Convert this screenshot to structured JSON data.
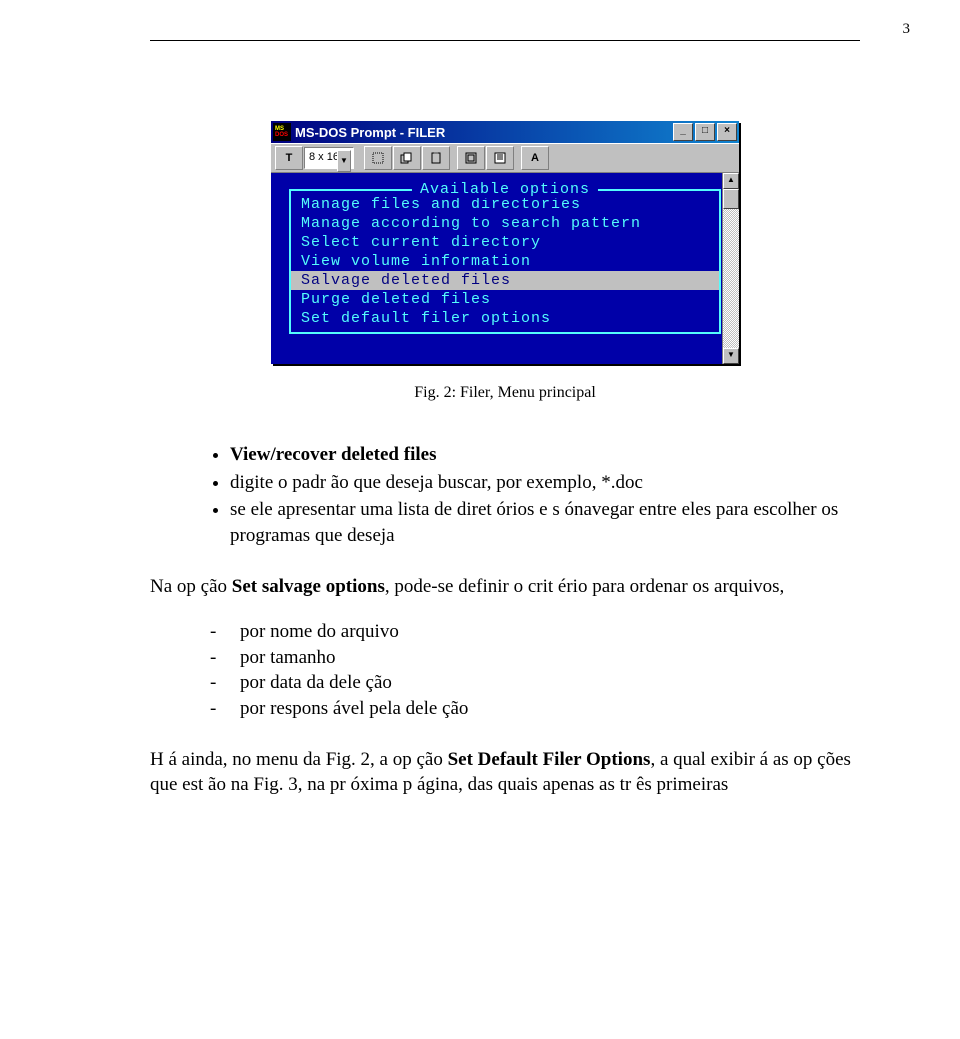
{
  "page_number": "3",
  "window": {
    "title": "MS-DOS Prompt - FILER",
    "font_size": "8 x 16",
    "toolbar_icons": {
      "t_icon": "T",
      "a_icon": "A"
    },
    "panel_title": "Available options",
    "options": [
      "Manage files and directories",
      "Manage according to search pattern",
      "Select current directory",
      "View volume information",
      "Salvage deleted files",
      "Purge deleted files",
      "Set default filer options"
    ],
    "selected_index": 4
  },
  "caption": "Fig. 2: Filer, Menu principal",
  "bullets": [
    {
      "prefix": "",
      "bold": "View/recover deleted files",
      "suffix": ""
    },
    {
      "prefix": "digite o padr ão que deseja buscar, por exemplo, *.doc",
      "bold": "",
      "suffix": ""
    },
    {
      "prefix": "se ele apresentar uma lista de diret órios e s ónavegar entre eles para escolher os programas que deseja",
      "bold": "",
      "suffix": ""
    }
  ],
  "para1": {
    "pre": "Na op ção ",
    "bold": "Set salvage options",
    "post": ", pode-se definir o crit ério para ordenar os arquivos,"
  },
  "dashes": [
    "por nome do arquivo",
    "por tamanho",
    "por data da dele ção",
    "por respons ável pela dele ção"
  ],
  "para2": {
    "t1": "H á ainda, no menu da Fig. 2, a op ção ",
    "b1": "Set Default Filer Options",
    "t2": ", a qual exibir á as op ções que est ão na Fig. 3, na pr óxima p ágina, das quais apenas as tr ês primeiras"
  }
}
